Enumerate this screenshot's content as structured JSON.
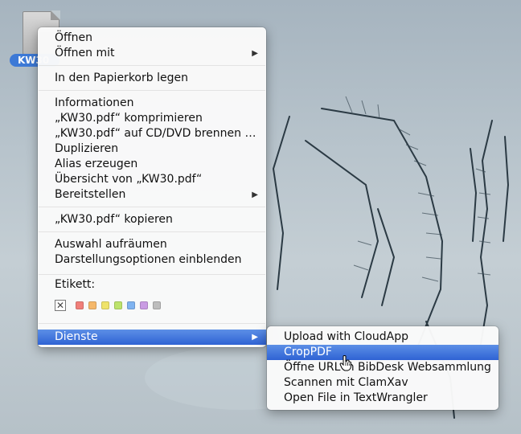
{
  "desktop": {
    "file_name": "KW30"
  },
  "context_menu": {
    "sections": [
      [
        {
          "label": "Öffnen",
          "submenu": false
        },
        {
          "label": "Öffnen mit",
          "submenu": true
        }
      ],
      [
        {
          "label": "In den Papierkorb legen",
          "submenu": false
        }
      ],
      [
        {
          "label": "Informationen",
          "submenu": false
        },
        {
          "label": "„KW30.pdf“ komprimieren",
          "submenu": false
        },
        {
          "label": "„KW30.pdf“ auf CD/DVD brennen …",
          "submenu": false
        },
        {
          "label": "Duplizieren",
          "submenu": false
        },
        {
          "label": "Alias erzeugen",
          "submenu": false
        },
        {
          "label": "Übersicht von „KW30.pdf“",
          "submenu": false
        },
        {
          "label": "Bereitstellen",
          "submenu": true
        }
      ],
      [
        {
          "label": "„KW30.pdf“ kopieren",
          "submenu": false
        }
      ],
      [
        {
          "label": "Auswahl aufräumen",
          "submenu": false
        },
        {
          "label": "Darstellungsoptionen einblenden",
          "submenu": false
        }
      ]
    ],
    "label_heading": "Etikett:",
    "label_none_symbol": "✕",
    "label_colors": [
      "#f07f7a",
      "#f5b86a",
      "#efe36a",
      "#bde36c",
      "#7fb3f0",
      "#c99be3",
      "#bdbdbd"
    ],
    "services_item": {
      "label": "Dienste",
      "submenu": true,
      "highlighted": true
    }
  },
  "services_submenu": {
    "items": [
      {
        "label": "Upload with CloudApp",
        "highlighted": false
      },
      {
        "label": "CropPDF",
        "highlighted": true
      },
      {
        "label": "Öffne URL in BibDesk Websammlung",
        "highlighted": false
      },
      {
        "label": "Scannen mit ClamXav",
        "highlighted": false
      },
      {
        "label": "Open File in TextWrangler",
        "highlighted": false
      }
    ]
  },
  "icons": {
    "submenu_arrow": "▶",
    "file": "pdf-file-icon",
    "pointer": "hand-pointer-icon"
  },
  "colors": {
    "highlight": "#3a6fd8",
    "file_label_bg": "#3d79d6"
  }
}
